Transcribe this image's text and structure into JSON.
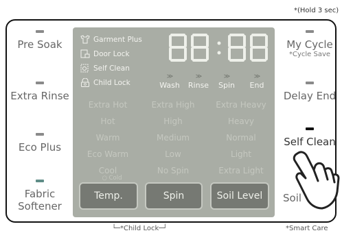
{
  "notes": {
    "hold": "*(Hold 3 sec)",
    "child_lock": "└─*Child Lock─┘",
    "smart_care": "*Smart Care"
  },
  "left_buttons": [
    {
      "label": "Pre Soak"
    },
    {
      "label": "Extra Rinse"
    },
    {
      "label": "Eco Plus"
    },
    {
      "label": "Fabric\nSoftener"
    }
  ],
  "right_buttons": [
    {
      "label": "My Cycle",
      "sub": "*Cycle Save"
    },
    {
      "label": "Delay End"
    },
    {
      "label": "Self Clean"
    },
    {
      "label": "Soil"
    }
  ],
  "display": {
    "indicators": [
      "Garment Plus",
      "Door Lock",
      "Self Clean",
      "Child Lock"
    ],
    "time_digits": "88:88",
    "wash_stages": [
      "Wash",
      "Rinse",
      "Spin",
      "End"
    ],
    "options": {
      "temp": [
        "Extra Hot",
        "Hot",
        "Warm",
        "Eco Warm",
        "Cool"
      ],
      "temp_sub": "○ Cold",
      "spin": [
        "Extra High",
        "High",
        "Medium",
        "Low",
        "No Spin"
      ],
      "soil": [
        "Extra Heavy",
        "Heavy",
        "Normal",
        "Light",
        "Extra Light"
      ]
    },
    "buttons": [
      "Temp.",
      "Spin",
      "Soil Level"
    ]
  },
  "colors": {
    "display_bg": "#a9ada5",
    "button_bg": "#767973",
    "led_active": "#111111",
    "led_teal": "#5f8d87"
  }
}
